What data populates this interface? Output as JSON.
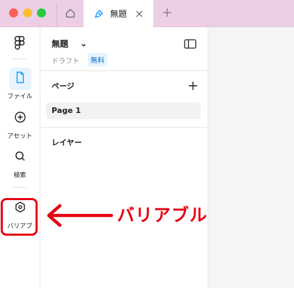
{
  "window": {
    "tab_title": "無題"
  },
  "rail": {
    "items": [
      {
        "label": "ファイル",
        "icon": "file-icon"
      },
      {
        "label": "アセット",
        "icon": "asset-icon"
      },
      {
        "label": "検索",
        "icon": "search-icon"
      },
      {
        "label": "バリアブ",
        "icon": "variable-icon"
      }
    ]
  },
  "panel": {
    "file_name": "無題",
    "draft_label": "ドラフト",
    "plan_badge": "無料",
    "pages_title": "ページ",
    "pages": [
      {
        "name": "Page 1",
        "selected": true
      }
    ],
    "layers_title": "レイヤー"
  },
  "annotation": {
    "label": "バリアブル",
    "color": "#e60012"
  },
  "colors": {
    "titlebar": "#eccfe6",
    "accent": "#0d99ff",
    "active_bg": "#e5f4ff"
  }
}
